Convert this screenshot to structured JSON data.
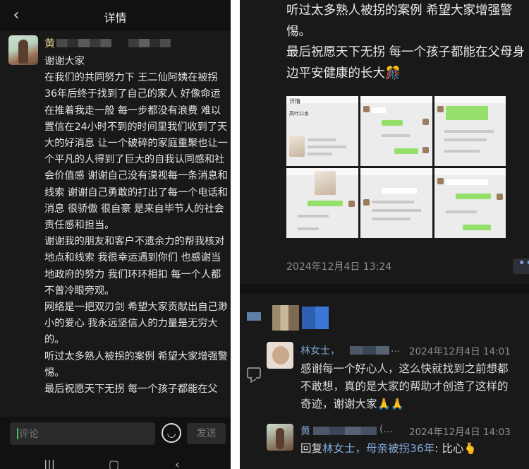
{
  "left_panel": {
    "header": {
      "back_icon": "chevron-left-icon",
      "title": "详情"
    },
    "post": {
      "author": "黄",
      "message_paragraphs": [
        "谢谢大家",
        "在我们的共同努力下 王二仙阿姨在被拐36年后终于找到了自己的家人 好像命运在推着我走一般 每一步都没有浪费 难以置信在24小时不到的时间里我们收到了天大的好消息 让一个破碎的家庭重聚也让一个平凡的人得到了巨大的自我认同感和社会价值感 谢谢自己没有漠视每一条消息和线索 谢谢自己勇敢的打出了每一个电话和消息 很骄傲 很自豪 是来自毕节人的社会责任感和担当。",
        "谢谢我的朋友和客户不遗余力的帮我核对地点和线索 我很幸运遇到你们 也感谢当地政府的努力 我们环环相扣 每一个人都不曾冷眼旁观。",
        "网络是一把双刃剑 希望大家贡献出自己渺小的爱心 我永远坚信人的力量是无穷大的。",
        "听过太多熟人被拐的案例 希望大家增强警惕。",
        "最后祝愿天下无拐 每一个孩子都能在父"
      ]
    },
    "comment_bar": {
      "placeholder": "评论",
      "emoji_icon": "smiley-icon",
      "send_label": "发送"
    },
    "nav": [
      "|||",
      "▢",
      "‹"
    ]
  },
  "right_panel": {
    "message_paragraphs": [
      "听过太多熟人被拐的案例 希望大家增强警惕。",
      "最后祝愿天下无拐 每一个孩子都能在父母身边平安健康的长大🎊"
    ],
    "image_grid": {
      "thumb_labels": [
        "详情",
        "",
        "",
        "",
        "",
        ""
      ],
      "thumb_caption": "高叶口水"
    },
    "timestamp": "2024年12月4日 13:24",
    "more_button_label": "••",
    "comments": [
      {
        "name": "林女士，",
        "name_suffix": "...",
        "time": "2024年12月4日 14:01",
        "text": "感谢每一个好心人，这么快就找到之前想都不敢想，真的是大家的帮助才创造了这样的奇迹，谢谢大家🙏🙏"
      },
      {
        "name": "黄",
        "name_suffix": "(...",
        "time": "2024年12月4日 14:03",
        "reply_prefix": "回复",
        "reply_to": "林女士，母亲被拐36年",
        "text": ": 比心🫰"
      }
    ]
  },
  "colors": {
    "background": "#191919",
    "name_gold": "#d8c48a",
    "link_blue": "#7fa8d8",
    "text_light": "#e3e3e3",
    "timestamp_gray": "#8d8d8d"
  }
}
